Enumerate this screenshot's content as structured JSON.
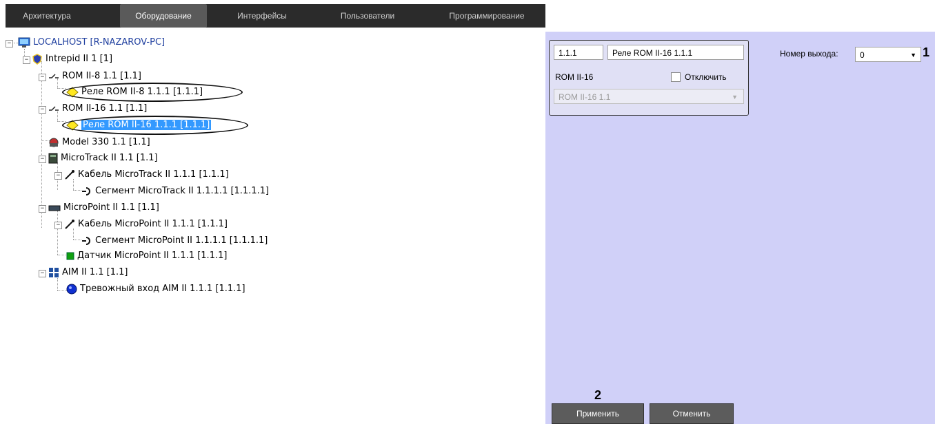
{
  "tabs": [
    "Архитектура",
    "Оборудование",
    "Интерфейсы",
    "Пользователи",
    "Программирование"
  ],
  "tree": {
    "root": "LOCALHOST [R-NAZAROV-PC]",
    "intrepid": "Intrepid II 1 [1]",
    "rom8": "ROM II-8 1.1 [1.1]",
    "relay8": "Реле ROM II-8  1.1.1 [1.1.1]",
    "rom16": "ROM II-16 1.1 [1.1]",
    "relay16": "Реле ROM II-16 1.1.1 [1.1.1]",
    "model330": "Model 330 1.1 [1.1]",
    "microtrack": "MicroTrack II 1.1 [1.1]",
    "mt_cable": "Кабель MicroTrack II 1.1.1 [1.1.1]",
    "mt_segment": "Сегмент MicroTrack II 1.1.1.1 [1.1.1.1]",
    "micropoint": "MicroPoint II 1.1 [1.1]",
    "mp_cable": "Кабель MicroPoint II 1.1.1 [1.1.1]",
    "mp_segment": "Сегмент MicroPoint II 1.1.1.1 [1.1.1.1]",
    "mp_sensor": "Датчик MicroPoint II 1.1.1 [1.1.1]",
    "aim": "AIM II 1.1 [1.1]",
    "aim_input": "Тревожный вход AIM II 1.1.1 [1.1.1]"
  },
  "settings": {
    "id_value": "1.1.1",
    "name_value": "Реле ROM II-16 1.1.1",
    "type_label": "ROM II-16",
    "disable_label": "Отключить",
    "parent_value": "ROM II-16 1.1",
    "output_label": "Номер выхода:",
    "output_value": "0"
  },
  "buttons": {
    "apply": "Применить",
    "cancel": "Отменить"
  },
  "markers": {
    "one": "1",
    "two": "2"
  }
}
